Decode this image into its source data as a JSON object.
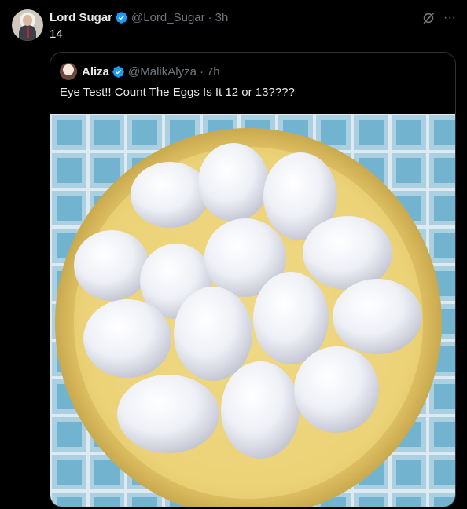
{
  "tweet": {
    "author_name": "Lord Sugar",
    "handle": "@Lord_Sugar",
    "separator": "·",
    "time": "3h",
    "text": "14"
  },
  "quoted_tweet": {
    "author_name": "Aliza",
    "handle": "@MalikAlyza",
    "separator": "·",
    "time": "7h",
    "text": "Eye Test!! Count The Eggs Is It 12 or 13????"
  },
  "icons": {
    "verified": "verified-badge-icon",
    "grok": "grok-icon",
    "more": "more-icon"
  },
  "colors": {
    "background": "#000000",
    "text": "#e7e9ea",
    "muted": "#71767b",
    "verified_blue": "#1d9bf0",
    "border": "#2f3336",
    "plate": "#e8cf7a",
    "tile_blue": "#5aa7c8"
  }
}
